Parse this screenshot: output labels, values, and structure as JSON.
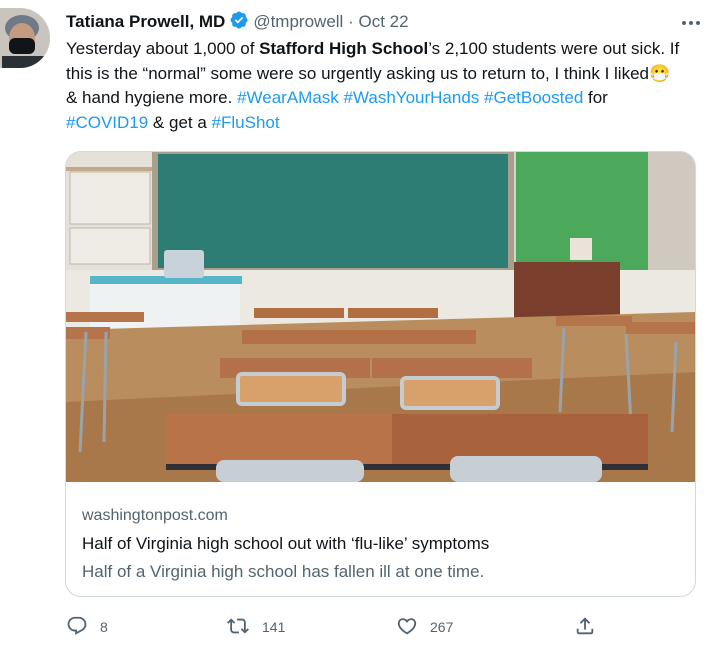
{
  "tweet": {
    "author_name": "Tatiana Prowell, MD",
    "handle": "@tmprowell",
    "separator": "·",
    "date": "Oct 22",
    "text": {
      "p1": "Yesterday about 1,000 of ",
      "bold": "Stafford High School",
      "p2": "’s 2,100 students were out sick. If this is the “normal” some were so urgently asking us to return to, I think I liked",
      "emoji": "😷",
      "p3": " & hand hygiene more. ",
      "tag1": "#WearAMask",
      "tag2": "#WashYourHands",
      "tag3": "#GetBoosted",
      "p4": " for ",
      "tag4": "#COVID19",
      "p5": " & get a ",
      "tag5": "#FluShot"
    }
  },
  "card": {
    "domain": "washingtonpost.com",
    "title": "Half of Virginia high school out with ‘flu-like’ symptoms",
    "description": "Half of a Virginia high school has fallen ill at one time."
  },
  "actions": {
    "replies": "8",
    "retweets": "141",
    "likes": "267"
  },
  "icons": [
    "verified-badge-icon",
    "more-icon",
    "reply-icon",
    "retweet-icon",
    "like-icon",
    "share-icon"
  ],
  "colors": {
    "link": "#1d9bf0",
    "secondary": "#536471",
    "verified": "#1d9bf0"
  }
}
